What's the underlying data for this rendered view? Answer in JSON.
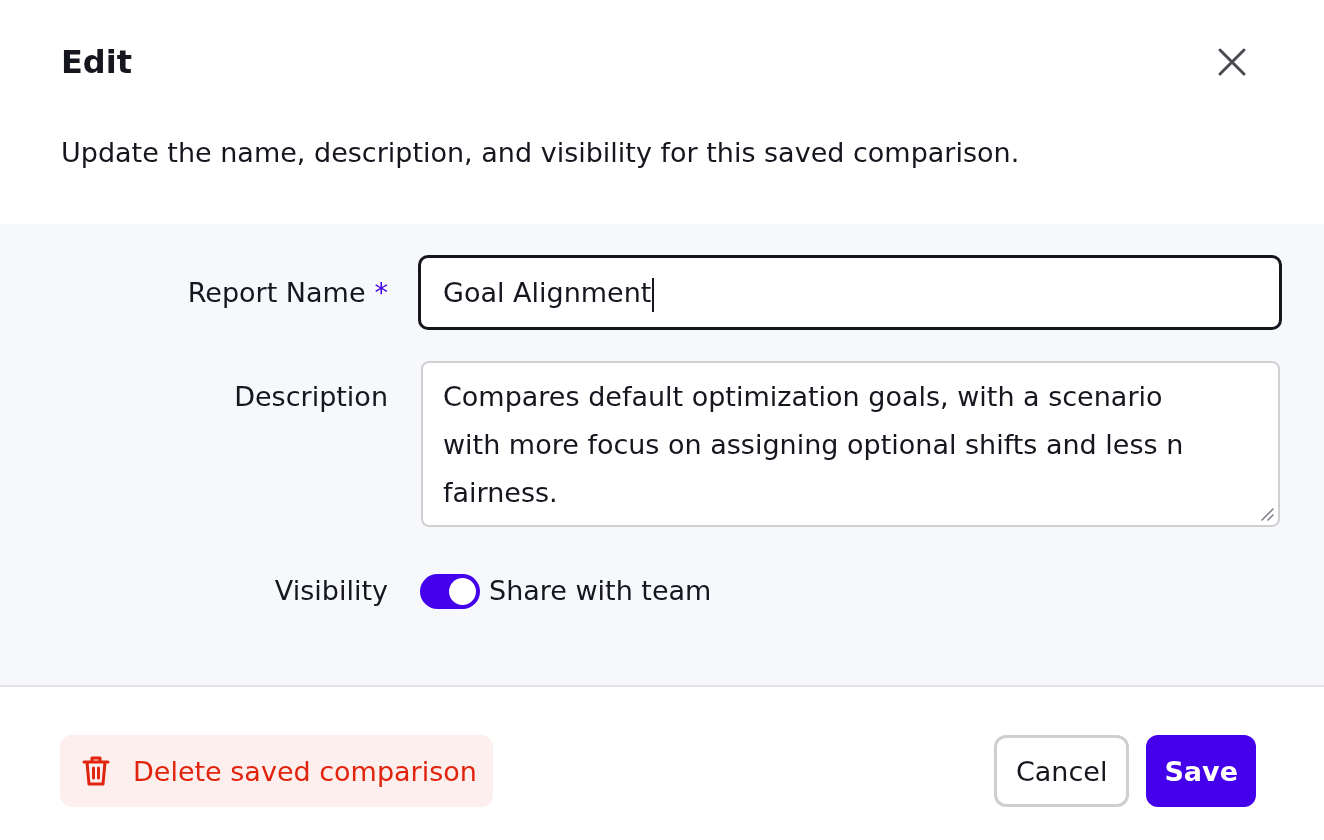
{
  "dialog": {
    "title": "Edit",
    "description": "Update the name, description, and visibility for this saved comparison."
  },
  "form": {
    "fields": [
      {
        "kind": "text",
        "label": "Report Name",
        "required": true,
        "required_mark": "*",
        "value": "Goal Alignment",
        "focused": true
      },
      {
        "kind": "textarea",
        "label": "Description",
        "required": false,
        "value": "Compares default optimization goals, with a scenario with more focus on assigning optional shifts and less n fairness.",
        "focused": false
      },
      {
        "kind": "toggle",
        "label": "Visibility",
        "on": true,
        "option_label": "Share with team"
      }
    ]
  },
  "footer": {
    "buttons": [
      {
        "kind": "danger",
        "label": "Delete saved comparison"
      },
      {
        "kind": "secondary",
        "label": "Cancel"
      },
      {
        "kind": "primary",
        "label": "Save"
      }
    ]
  }
}
